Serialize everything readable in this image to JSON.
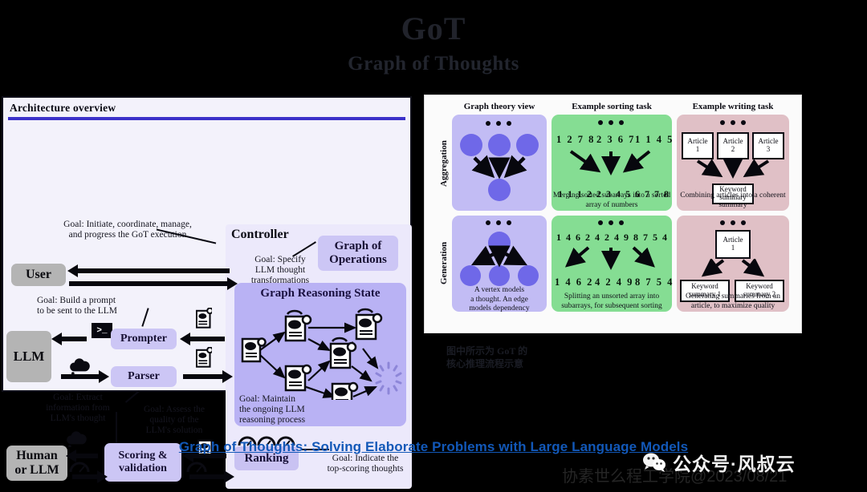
{
  "title": {
    "main": "GoT",
    "subtitle": "Graph of Thoughts"
  },
  "architecture": {
    "header": "Architecture overview",
    "goals": {
      "user": "Goal: Initiate, coordinate, manage,\nand progress the GoT execution",
      "prompter": "Goal: Build a prompt\nto be sent to the LLM",
      "parser": "Goal: Extract\ninformation from\nLLM's thought",
      "scoring": "Goal: Assess the\nquality of the\nLLM's solution",
      "controller": "Goal: Specify\nLLM thought\ntransformations",
      "graph_state": "Goal: Maintain\nthe ongoing LLM\nreasoning process",
      "ranking": "Goal: Indicate the\ntop-scoring thoughts"
    },
    "goal_label": "Goal",
    "boxes": {
      "user": "User",
      "llm": "LLM",
      "prompter": "Prompter",
      "parser": "Parser",
      "human_or_llm": "Human\nor LLM",
      "scoring": "Scoring &\nvalidation",
      "ranking": "Ranking",
      "controller": "Controller",
      "graph_of_operations": "Graph of\nOperations",
      "graph_reasoning_state": "Graph Reasoning State"
    },
    "icons": {
      "terminal": ">_",
      "document": "document-icon",
      "cloud": "thought-cloud-icon",
      "gauge": "gauge-icon",
      "gear": "gear-icon"
    }
  },
  "tasks": {
    "columns": [
      "Graph theory view",
      "Example sorting task",
      "Example writing task"
    ],
    "rows": [
      "Aggregation",
      "Generation"
    ],
    "aggregation": {
      "graph_caption": "",
      "sorting": {
        "inputs": [
          "1 2 7 8",
          "2 3 6 7",
          "1 1 4 5"
        ],
        "output": "1 1 1 2 2 3 4 5 6 7 7 8",
        "caption": "Merging sorted subarrays\ninto a sorted array of numbers"
      },
      "writing": {
        "inputs": [
          "Article\n1",
          "Article\n2",
          "Article\n3"
        ],
        "output": "Keyword\nsummary",
        "caption": "Combining articles into\na coherent summary"
      }
    },
    "generation": {
      "graph_caption": "A vertex models\na thought. An edge\nmodels dependency",
      "sorting": {
        "input": "1 4 6 2 4 2 4 9 8 7 5 4",
        "outputs": [
          "1 4 6 2",
          "4 2 4 9",
          "8 7 5 4"
        ],
        "caption": "Splitting an unsorted array into\nsubarrays, for subsequent sorting"
      },
      "writing": {
        "input": "Article\n1",
        "outputs": [
          "Keyword\nsummary 1",
          "Keyword\nsummary 2"
        ],
        "caption": "Generating summaries from\nan article, to maximize quality"
      }
    }
  },
  "note": {
    "text": "图中所示为 GoT 的\n核心推理流程示意"
  },
  "link": {
    "text": "Graph of Thoughts: Solving Elaborate Problems with Large Language Models"
  },
  "watermark": {
    "text": "公众号·风叔云",
    "ghost": "协素世么程工学院@2023/08/21",
    "logo": "wechat-logo-icon"
  },
  "colors": {
    "accent_blue": "#3b31c9",
    "link_blue": "#1258b8",
    "purple_cell": "#c2bcf4",
    "green_cell": "#85dd93",
    "pink_cell": "#e0c0c6",
    "node_blue": "#6f68e8",
    "gray_box": "#b4b4b4",
    "violet_box": "#ccc6f5"
  }
}
